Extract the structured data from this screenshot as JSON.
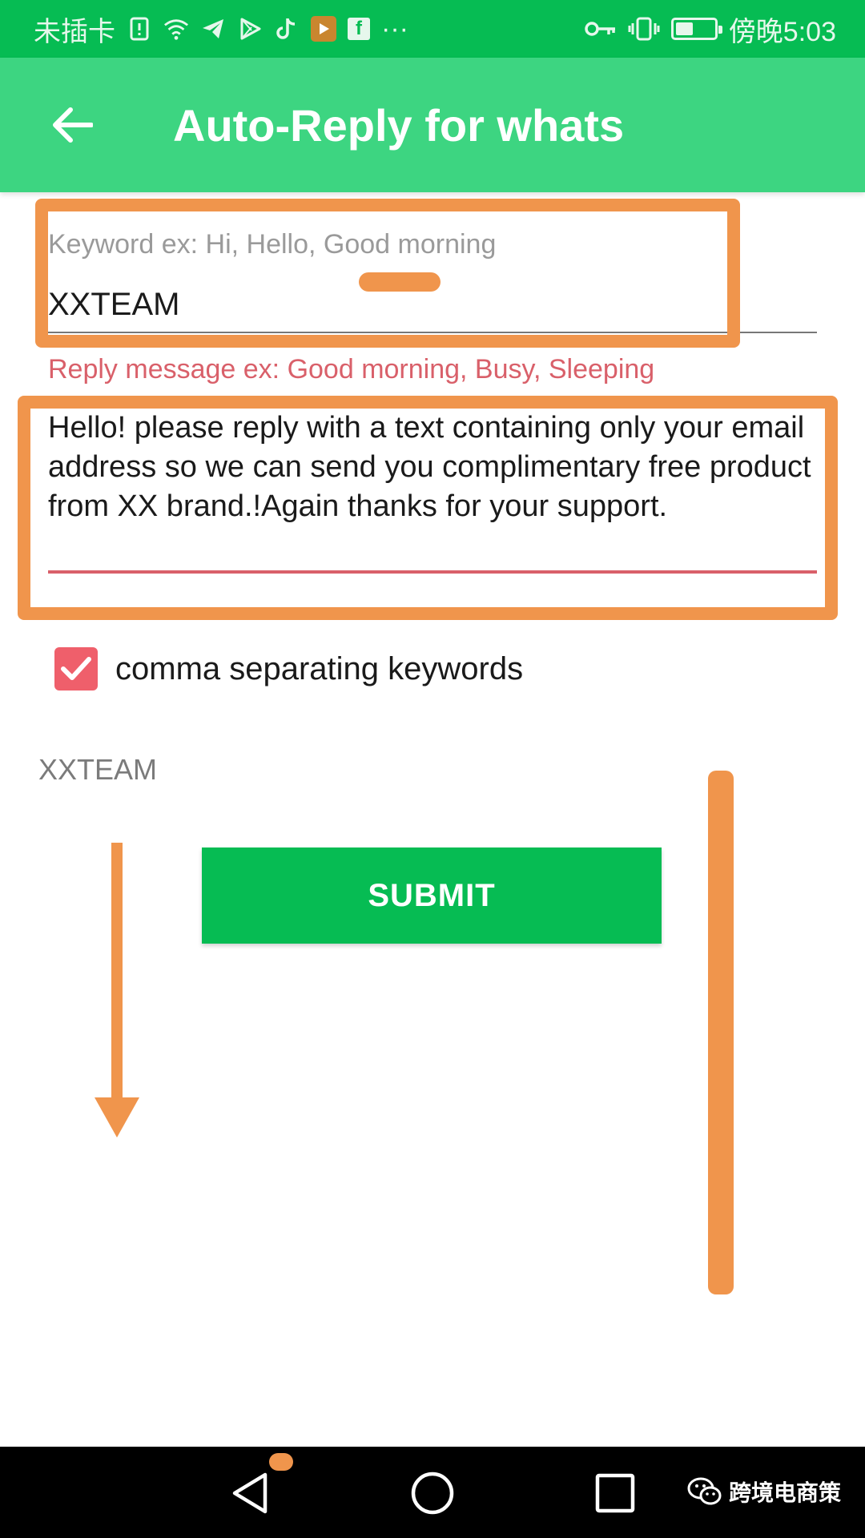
{
  "status_bar": {
    "carrier": "未插卡",
    "more": "···",
    "time": "傍晚5:03",
    "battery_level": 0.45,
    "icons": [
      "sim-alert-icon",
      "wifi-icon",
      "telegram-icon",
      "play-store-icon",
      "tiktok-icon",
      "video-app-icon",
      "facebook-icon",
      "key-icon",
      "vibrate-icon",
      "battery-icon"
    ]
  },
  "app_bar": {
    "title": "Auto-Reply for whats",
    "back_icon": "arrow-left-icon"
  },
  "keyword_field": {
    "hint": "Keyword ex: Hi, Hello, Good morning",
    "value": "XXTEAM"
  },
  "reply_field": {
    "hint": "Reply message ex: Good morning, Busy, Sleeping",
    "value": "Hello! please reply with a text containing only your email address so we can send you complimentary free product from XX brand.!Again thanks for your support."
  },
  "comma_checkbox": {
    "label": "comma separating keywords",
    "checked": true
  },
  "echo_text": "XXTEAM",
  "submit": {
    "label": "SUBMIT"
  },
  "watermark": {
    "text": "跨境电商策"
  },
  "colors": {
    "status_green": "#06bc53",
    "appbar_green": "#3dd581",
    "accent_red": "#d9606a",
    "checkbox_red": "#ef5f6b",
    "annotation_orange": "#f0954c"
  }
}
